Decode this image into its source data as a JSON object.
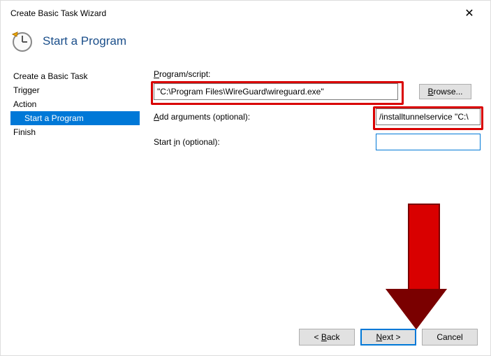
{
  "window": {
    "title": "Create Basic Task Wizard"
  },
  "header": {
    "title": "Start a Program"
  },
  "sidebar": {
    "items": [
      {
        "label": "Create a Basic Task"
      },
      {
        "label": "Trigger"
      },
      {
        "label": "Action"
      },
      {
        "label": "Start a Program"
      },
      {
        "label": "Finish"
      }
    ]
  },
  "form": {
    "program_label_pre": "P",
    "program_label_post": "rogram/script:",
    "program_value": "\"C:\\Program Files\\WireGuard\\wireguard.exe\"",
    "browse_label_pre": "B",
    "browse_label_post": "rowse...",
    "args_label_pre": "A",
    "args_label_post": "dd arguments (optional):",
    "args_value": "/installtunnelservice \"C:\\",
    "startin_label_pre": "Start ",
    "startin_label_u": "i",
    "startin_label_post": "n (optional):",
    "startin_value": ""
  },
  "buttons": {
    "back_pre": "< ",
    "back_u": "B",
    "back_post": "ack",
    "next_u": "N",
    "next_post": "ext >",
    "cancel": "Cancel"
  }
}
